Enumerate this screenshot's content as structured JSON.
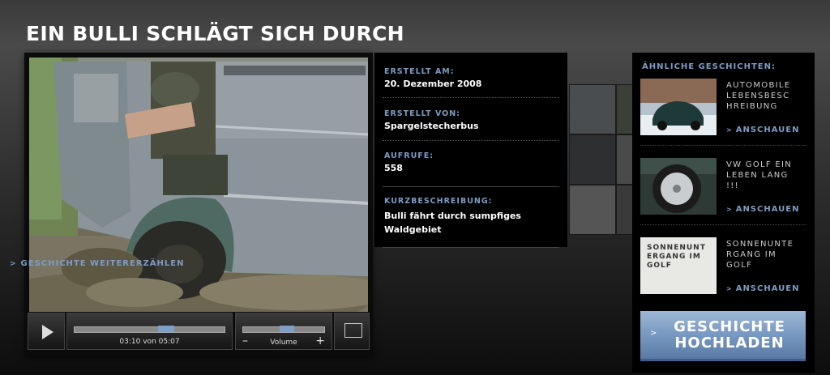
{
  "page": {
    "title": "EIN BULLI SCHLÄGT SICH DURCH"
  },
  "player": {
    "time_current": "03:10",
    "time_sep": "von",
    "time_total": "05:07",
    "time_label": "03:10 von 05:07",
    "volume_label": "Volume",
    "volume_minus": "–",
    "volume_plus": "+",
    "progress_fraction": 0.62,
    "volume_fraction": 0.55
  },
  "info": {
    "created_label": "ERSTELLT AM:",
    "created_value": "20. Dezember 2008",
    "author_label": "ERSTELLT VON:",
    "author_value": "Spargelstecherbus",
    "views_label": "AUFRUFE:",
    "views_value": "558",
    "desc_label": "KURZBESCHREIBUNG:",
    "desc_value": "Bulli fährt durch sumpfiges Waldgebiet",
    "retell_link": "GESCHICHTE WEITERERZÄHLEN"
  },
  "similar": {
    "heading": "ÄHNLICHE GESCHICHTEN:",
    "items": [
      {
        "title": "AUTOMOBILE LEBENSBESC HREIBUNG",
        "link": "ANSCHAUEN"
      },
      {
        "title": "VW GOLF EIN LEBEN LANG !!!",
        "link": "ANSCHAUEN"
      },
      {
        "title": "SONNENUNTE RGANG IM GOLF",
        "link": "ANSCHAUEN",
        "thumb_text": "SONNENUNT ERGANG IM GOLF"
      }
    ]
  },
  "upload": {
    "label": "GESCHICHTE HOCHLADEN"
  },
  "colors": {
    "accent": "#7d9cc4",
    "upload_bg": "#7798c0"
  }
}
